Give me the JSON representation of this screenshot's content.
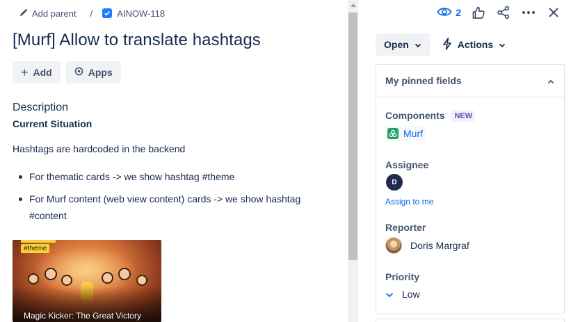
{
  "breadcrumb": {
    "add_parent": "Add parent",
    "separator": "/",
    "issue_key": "AINOW-118"
  },
  "issue": {
    "title": "[Murf] Allow to translate hashtags"
  },
  "toolbar": {
    "add_label": "Add",
    "apps_label": "Apps"
  },
  "description": {
    "heading": "Description",
    "subheading": "Current Situation",
    "paragraph": "Hashtags are hardcoded in the backend",
    "bullets": [
      "For thematic cards -> we show hashtag #theme",
      "For Murf content (web view content) cards -> we show hashtag #content"
    ],
    "image": {
      "tag": "#theme",
      "caption": "Magic Kicker: The Great Victory"
    }
  },
  "header_actions": {
    "watchers_count": "2",
    "icons": [
      "eye-icon",
      "thumbs-up-icon",
      "share-icon",
      "more-icon",
      "close-icon"
    ]
  },
  "status": {
    "current": "Open",
    "actions_label": "Actions"
  },
  "pinned_fields": {
    "title": "My pinned fields",
    "components": {
      "label": "Components",
      "badge": "NEW",
      "value": "Murf"
    },
    "assignee": {
      "label": "Assignee",
      "avatar_initial": "D",
      "assign_link": "Assign to me"
    },
    "reporter": {
      "label": "Reporter",
      "name": "Doris Margraf"
    },
    "priority": {
      "label": "Priority",
      "value": "Low"
    }
  },
  "colors": {
    "link": "#0c66e4",
    "text": "#172b4d",
    "subtle": "#44546f",
    "button_bg": "#f1f2f4",
    "component_green": "#22a06b",
    "new_lozenge": "#5e4db2"
  }
}
